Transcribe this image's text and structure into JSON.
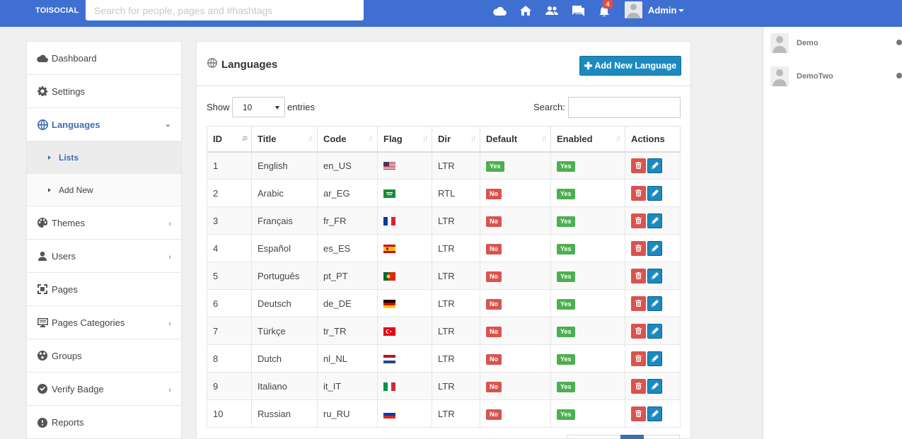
{
  "topbar": {
    "brand": "TOISOCIAL",
    "search_placeholder": "Search for people, pages and #hashtags",
    "notification_count": "4",
    "user_name": "Admin",
    "bg_color": "#3f70d1"
  },
  "sidebar": {
    "items": [
      {
        "label": "Dashboard",
        "icon": "cloud-icon"
      },
      {
        "label": "Settings",
        "icon": "gear-icon"
      },
      {
        "label": "Languages",
        "icon": "globe-icon"
      },
      {
        "label": "Themes",
        "icon": "palette-icon"
      },
      {
        "label": "Users",
        "icon": "user-icon"
      },
      {
        "label": "Pages",
        "icon": "pages-icon"
      },
      {
        "label": "Pages Categories",
        "icon": "monitor-icon"
      },
      {
        "label": "Groups",
        "icon": "groups-icon"
      },
      {
        "label": "Verify Badge",
        "icon": "check-circle-icon"
      },
      {
        "label": "Reports",
        "icon": "alert-circle-icon"
      }
    ],
    "languages_sub": [
      {
        "label": "Lists"
      },
      {
        "label": "Add New"
      }
    ]
  },
  "main": {
    "title": "Languages",
    "add_button": "Add New Language",
    "show_label": "Show",
    "entries_value": "10",
    "entries_label": "entries",
    "search_label": "Search:",
    "columns": [
      "ID",
      "Title",
      "Code",
      "Flag",
      "Dir",
      "Default",
      "Enabled",
      "Actions"
    ],
    "rows": [
      {
        "id": "1",
        "title": "English",
        "code": "en_US",
        "flag": "us",
        "dir": "LTR",
        "default": "Yes",
        "enabled": "Yes"
      },
      {
        "id": "2",
        "title": "Arabic",
        "code": "ar_EG",
        "flag": "sa",
        "dir": "RTL",
        "default": "No",
        "enabled": "Yes"
      },
      {
        "id": "3",
        "title": "Français",
        "code": "fr_FR",
        "flag": "fr",
        "dir": "LTR",
        "default": "No",
        "enabled": "Yes"
      },
      {
        "id": "4",
        "title": "Español",
        "code": "es_ES",
        "flag": "es",
        "dir": "LTR",
        "default": "No",
        "enabled": "Yes"
      },
      {
        "id": "5",
        "title": "Português",
        "code": "pt_PT",
        "flag": "pt",
        "dir": "LTR",
        "default": "No",
        "enabled": "Yes"
      },
      {
        "id": "6",
        "title": "Deutsch",
        "code": "de_DE",
        "flag": "de",
        "dir": "LTR",
        "default": "No",
        "enabled": "Yes"
      },
      {
        "id": "7",
        "title": "Türkçe",
        "code": "tr_TR",
        "flag": "tr",
        "dir": "LTR",
        "default": "No",
        "enabled": "Yes"
      },
      {
        "id": "8",
        "title": "Dutch",
        "code": "nl_NL",
        "flag": "nl",
        "dir": "LTR",
        "default": "No",
        "enabled": "Yes"
      },
      {
        "id": "9",
        "title": "Italiano",
        "code": "it_IT",
        "flag": "it",
        "dir": "LTR",
        "default": "No",
        "enabled": "Yes"
      },
      {
        "id": "10",
        "title": "Russian",
        "code": "ru_RU",
        "flag": "ru",
        "dir": "LTR",
        "default": "No",
        "enabled": "Yes"
      }
    ]
  },
  "online_users": [
    {
      "name": "Demo"
    },
    {
      "name": "DemoTwo"
    }
  ]
}
